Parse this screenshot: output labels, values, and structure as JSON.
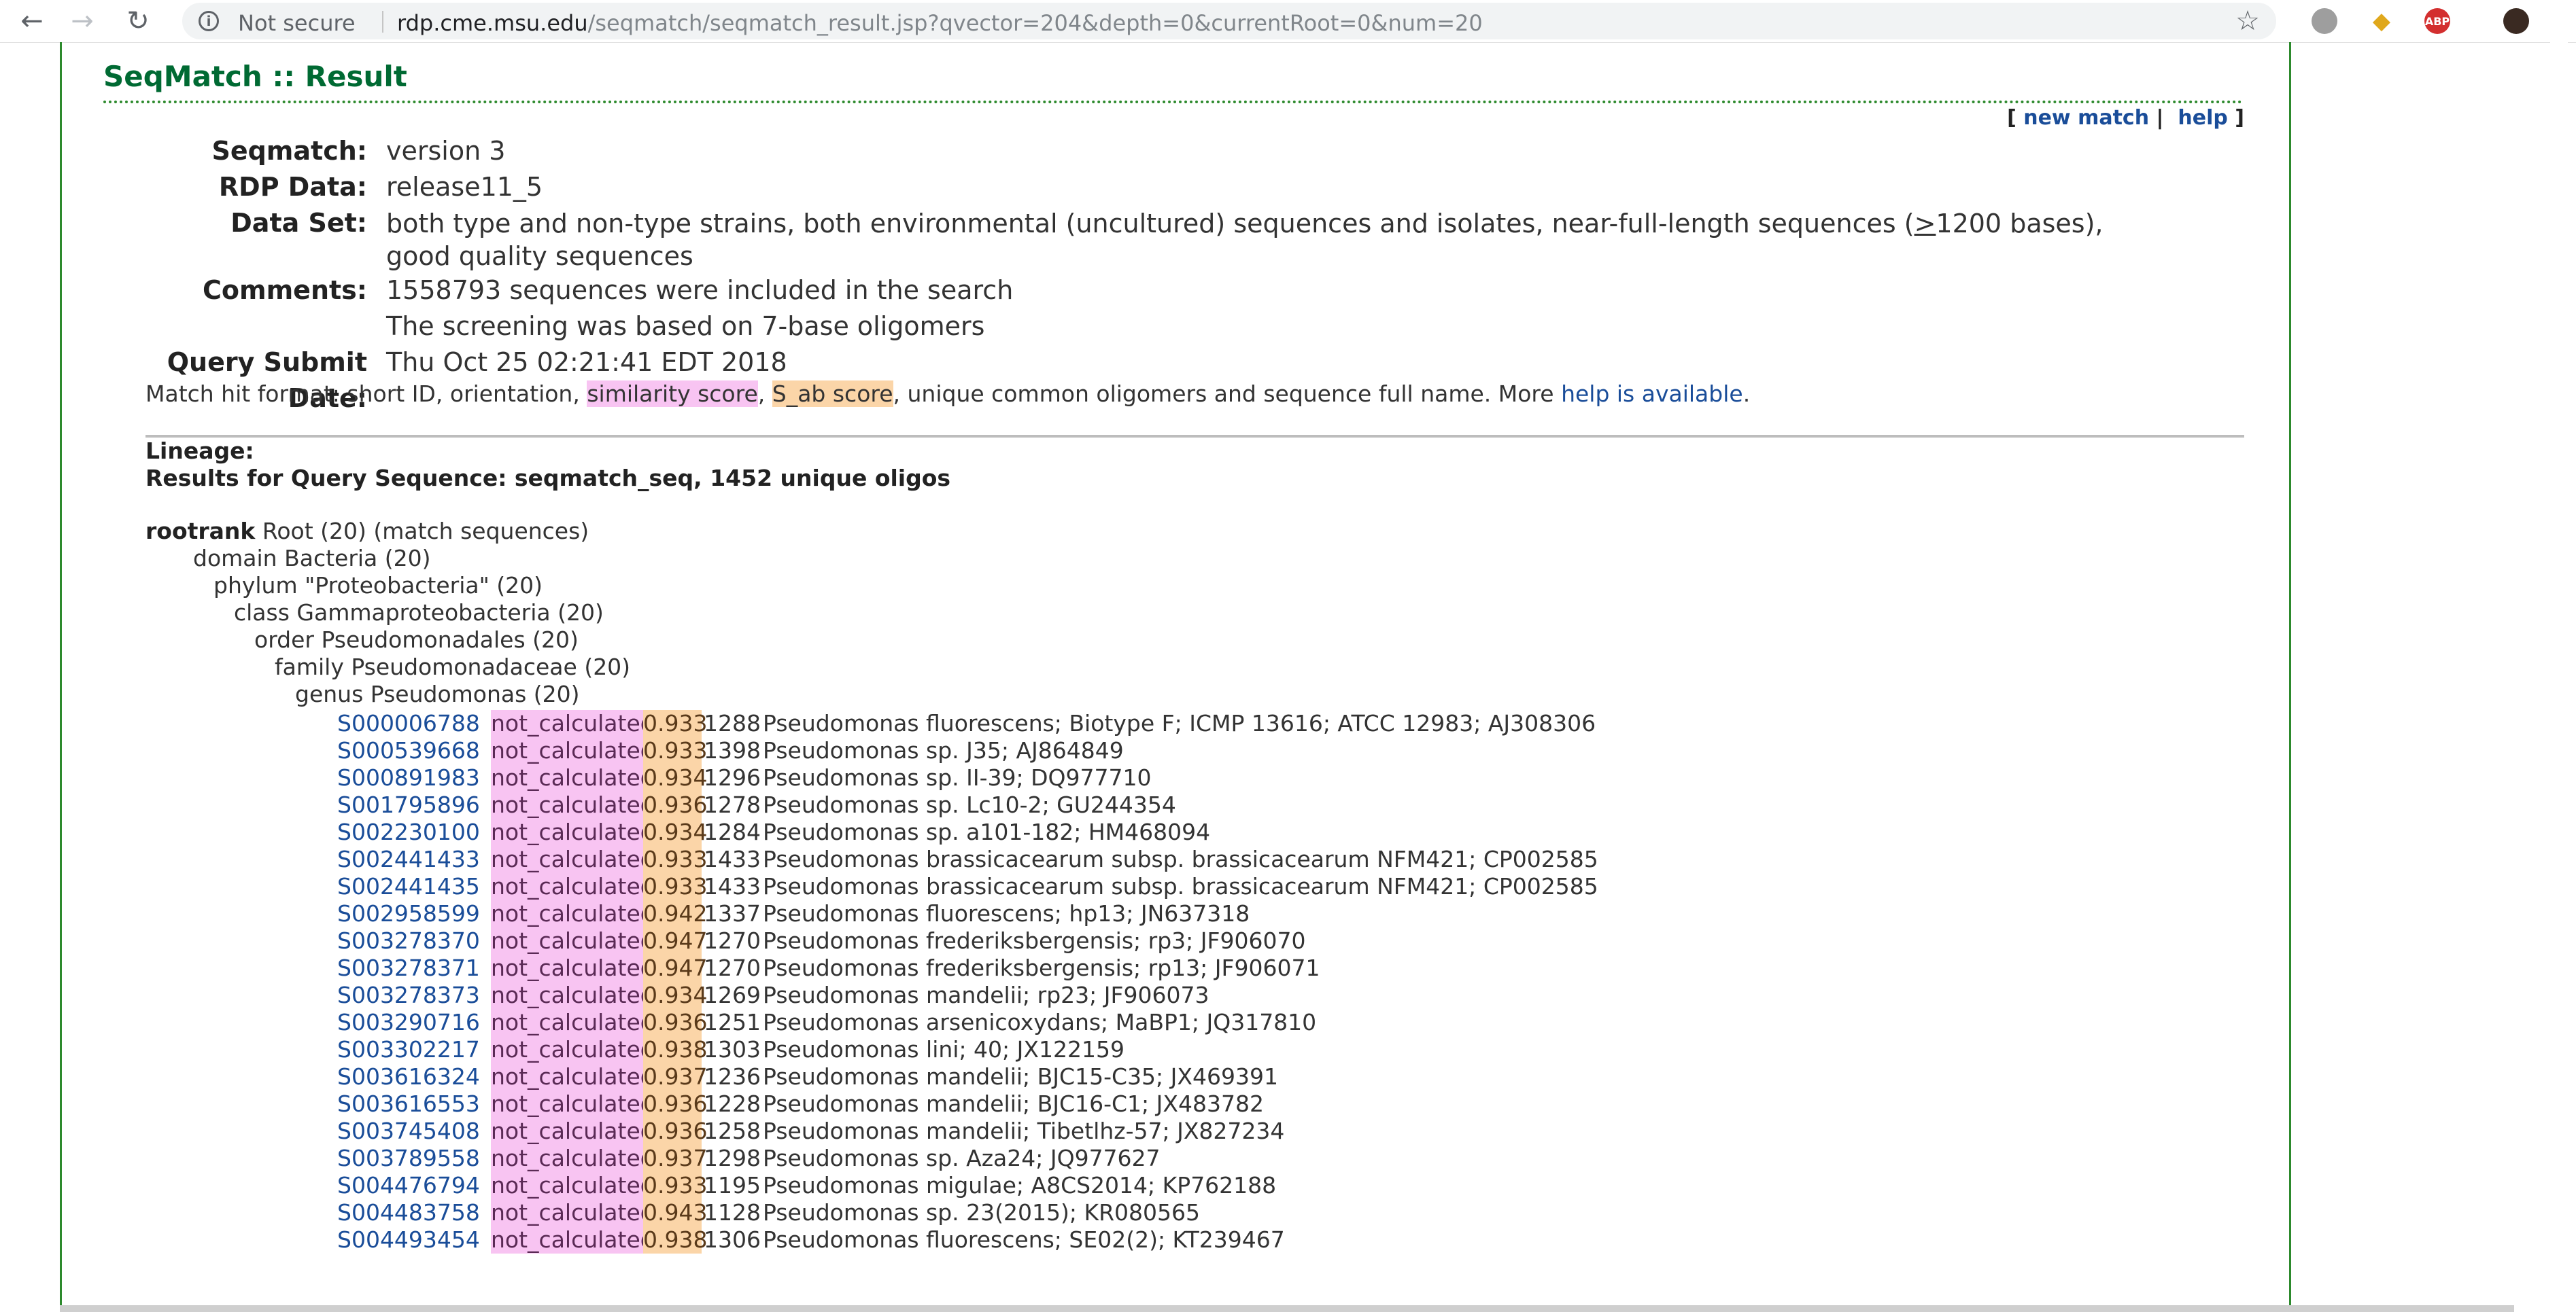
{
  "browser": {
    "security_label": "Not secure",
    "url_host": "rdp.cme.msu.edu",
    "url_path": "/seqmatch/seqmatch_result.jsp?qvector=204&depth=0&currentRoot=0&num=20",
    "ext_abp_label": "ABP"
  },
  "page": {
    "title": "SeqMatch :: Result",
    "links": {
      "new_match": "new match",
      "help": "help"
    }
  },
  "info": [
    {
      "label": "Seqmatch:",
      "value": "version 3"
    },
    {
      "label": "RDP Data:",
      "value": "release11_5"
    },
    {
      "label": "Data Set:",
      "value_pre": "both type and non-type strains, both environmental (uncultured) sequences and isolates, near-full-length sequences (",
      "value_u": ">",
      "value_post": "1200 bases), good quality sequences"
    },
    {
      "label": "Comments:",
      "value": "1558793 sequences were included in the search",
      "value2": "The screening was based on 7-base oligomers"
    },
    {
      "label": "Query Submit Date:",
      "value": "Thu Oct 25 02:21:41 EDT 2018"
    }
  ],
  "format": {
    "pre": "Match hit format: short ID, orientation, ",
    "sim": "similarity score",
    "comma": ", ",
    "sab": "S_ab score",
    "post": ", unique common oligomers and sequence full name. More ",
    "link": "help is available",
    "end": "."
  },
  "lineage_label": "Lineage:",
  "results_label": "Results for Query Sequence: seqmatch_seq, 1452 unique oligos",
  "tree": [
    {
      "rank": "rootrank",
      "text": "Root (20) (match sequences)"
    },
    {
      "text": "domain Bacteria (20)"
    },
    {
      "text": "phylum \"Proteobacteria\" (20)"
    },
    {
      "text": "class Gammaproteobacteria (20)"
    },
    {
      "text": "order Pseudomonadales (20)"
    },
    {
      "text": "family Pseudomonadaceae (20)"
    },
    {
      "text": "genus Pseudomonas (20)"
    }
  ],
  "hits": [
    {
      "id": "S000006788",
      "sim": "not_calculated",
      "sab": "0.933",
      "oligos": "1288",
      "name": "Pseudomonas fluorescens; Biotype F; ICMP 13616; ATCC 12983; AJ308306"
    },
    {
      "id": "S000539668",
      "sim": "not_calculated",
      "sab": "0.933",
      "oligos": "1398",
      "name": "Pseudomonas sp. J35; AJ864849"
    },
    {
      "id": "S000891983",
      "sim": "not_calculated",
      "sab": "0.934",
      "oligos": "1296",
      "name": "Pseudomonas sp. II-39; DQ977710"
    },
    {
      "id": "S001795896",
      "sim": "not_calculated",
      "sab": "0.936",
      "oligos": "1278",
      "name": "Pseudomonas sp. Lc10-2; GU244354"
    },
    {
      "id": "S002230100",
      "sim": "not_calculated",
      "sab": "0.934",
      "oligos": "1284",
      "name": "Pseudomonas sp. a101-182; HM468094"
    },
    {
      "id": "S002441433",
      "sim": "not_calculated",
      "sab": "0.933",
      "oligos": "1433",
      "name": "Pseudomonas brassicacearum subsp. brassicacearum NFM421; CP002585"
    },
    {
      "id": "S002441435",
      "sim": "not_calculated",
      "sab": "0.933",
      "oligos": "1433",
      "name": "Pseudomonas brassicacearum subsp. brassicacearum NFM421; CP002585"
    },
    {
      "id": "S002958599",
      "sim": "not_calculated",
      "sab": "0.942",
      "oligos": "1337",
      "name": "Pseudomonas fluorescens; hp13; JN637318"
    },
    {
      "id": "S003278370",
      "sim": "not_calculated",
      "sab": "0.947",
      "oligos": "1270",
      "name": "Pseudomonas frederiksbergensis; rp3; JF906070"
    },
    {
      "id": "S003278371",
      "sim": "not_calculated",
      "sab": "0.947",
      "oligos": "1270",
      "name": "Pseudomonas frederiksbergensis; rp13; JF906071"
    },
    {
      "id": "S003278373",
      "sim": "not_calculated",
      "sab": "0.934",
      "oligos": "1269",
      "name": "Pseudomonas mandelii; rp23; JF906073"
    },
    {
      "id": "S003290716",
      "sim": "not_calculated",
      "sab": "0.936",
      "oligos": "1251",
      "name": "Pseudomonas arsenicoxydans; MaBP1; JQ317810"
    },
    {
      "id": "S003302217",
      "sim": "not_calculated",
      "sab": "0.938",
      "oligos": "1303",
      "name": "Pseudomonas lini; 40; JX122159"
    },
    {
      "id": "S003616324",
      "sim": "not_calculated",
      "sab": "0.937",
      "oligos": "1236",
      "name": "Pseudomonas mandelii; BJC15-C35; JX469391"
    },
    {
      "id": "S003616553",
      "sim": "not_calculated",
      "sab": "0.936",
      "oligos": "1228",
      "name": "Pseudomonas mandelii; BJC16-C1; JX483782"
    },
    {
      "id": "S003745408",
      "sim": "not_calculated",
      "sab": "0.936",
      "oligos": "1258",
      "name": "Pseudomonas mandelii; Tibetlhz-57; JX827234"
    },
    {
      "id": "S003789558",
      "sim": "not_calculated",
      "sab": "0.937",
      "oligos": "1298",
      "name": "Pseudomonas sp. Aza24; JQ977627"
    },
    {
      "id": "S004476794",
      "sim": "not_calculated",
      "sab": "0.933",
      "oligos": "1195",
      "name": "Pseudomonas migulae; A8CS2014; KP762188"
    },
    {
      "id": "S004483758",
      "sim": "not_calculated",
      "sab": "0.943",
      "oligos": "1128",
      "name": "Pseudomonas sp. 23(2015); KR080565"
    },
    {
      "id": "S004493454",
      "sim": "not_calculated",
      "sab": "0.938",
      "oligos": "1306",
      "name": "Pseudomonas fluorescens; SE02(2); KT239467"
    }
  ],
  "colors": {
    "title": "#006a33",
    "frame": "#2d8a2d",
    "link": "#1a4d99",
    "similarity_highlight": "#f8c4f2",
    "sab_highlight": "#fbd5a8"
  },
  "icons": [
    "back-icon",
    "forward-icon",
    "reload-icon",
    "info-icon",
    "star-icon",
    "elephant-extension-icon",
    "diamond-extension-icon",
    "abp-extension-icon",
    "profile-avatar"
  ]
}
